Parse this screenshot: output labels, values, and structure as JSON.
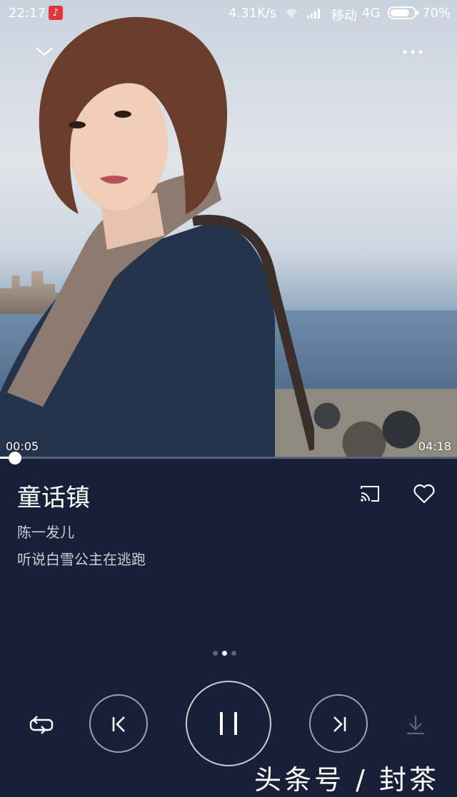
{
  "status_bar": {
    "time": "22:17",
    "net_speed": "4.31K/s",
    "carrier": "移动",
    "network": "4G",
    "battery": "70%"
  },
  "player": {
    "elapsed": "00:05",
    "duration": "04:18",
    "progress": 0.019,
    "song_title": "童话镇",
    "artist": "陈一发儿",
    "lyric_line": "听说白雪公主在逃跑",
    "page_indicator": {
      "count": 3,
      "active_index": 1
    }
  },
  "icons": {
    "collapse": "chevron-down-icon",
    "more": "more-dots-icon",
    "cast": "cast-icon",
    "favorite": "heart-icon",
    "repeat": "repeat-icon",
    "previous": "previous-track-icon",
    "pause": "pause-icon",
    "next": "next-track-icon",
    "download": "download-icon"
  },
  "watermark": "头条号 / 封茶",
  "colors": {
    "background": "#172036",
    "accent": "#ffffff",
    "muted_text": "#c9ced8"
  }
}
